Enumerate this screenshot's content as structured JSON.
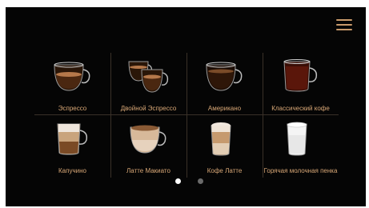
{
  "colors": {
    "background": "#050505",
    "accent": "#c99a6b",
    "label": "#d9a877",
    "divider": "#3a3128"
  },
  "menu": {
    "icon": "hamburger-menu-icon"
  },
  "drinks": [
    {
      "label": "Эспрессо",
      "icon": "espresso-cup-icon"
    },
    {
      "label": "Двойной Эспрессо",
      "icon": "double-espresso-cups-icon"
    },
    {
      "label": "Американо",
      "icon": "americano-cup-icon"
    },
    {
      "label": "Классический кофе",
      "icon": "classic-coffee-cup-icon"
    },
    {
      "label": "Капучино",
      "icon": "cappuccino-glass-icon"
    },
    {
      "label": "Латте Макиато",
      "icon": "latte-macchiato-cup-icon"
    },
    {
      "label": "Кофе Латте",
      "icon": "caffe-latte-glass-icon"
    },
    {
      "label": "Горячая молочная пенка",
      "icon": "hot-milk-foam-glass-icon"
    }
  ],
  "pagination": {
    "current_page": 1,
    "total_pages": 2
  }
}
